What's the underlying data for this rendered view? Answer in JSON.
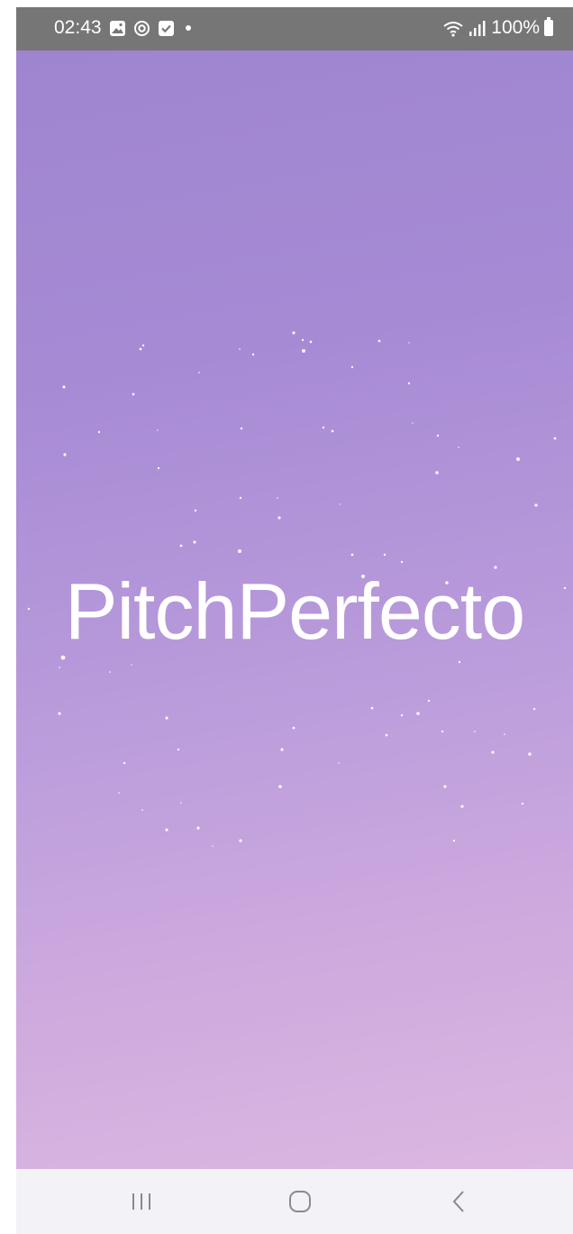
{
  "status_bar": {
    "time": "02:43",
    "battery": "100%",
    "left_icons": [
      "gallery-icon",
      "sync-icon",
      "checkbox-icon",
      "notification-dot-icon"
    ],
    "right_icons": [
      "wifi-icon",
      "signal-icon",
      "battery-icon"
    ]
  },
  "splash": {
    "title": "PitchPerfecto",
    "decoration": "particles"
  },
  "nav_bar": {
    "buttons": [
      "recent-apps-icon",
      "home-icon",
      "back-icon"
    ]
  },
  "colors": {
    "gradient_top": "#9e84cf",
    "gradient_bottom": "#dbb8e1",
    "status_bar_bg": "#767676",
    "nav_bar_bg": "#f3f2f7",
    "title_color": "#ffffff"
  }
}
